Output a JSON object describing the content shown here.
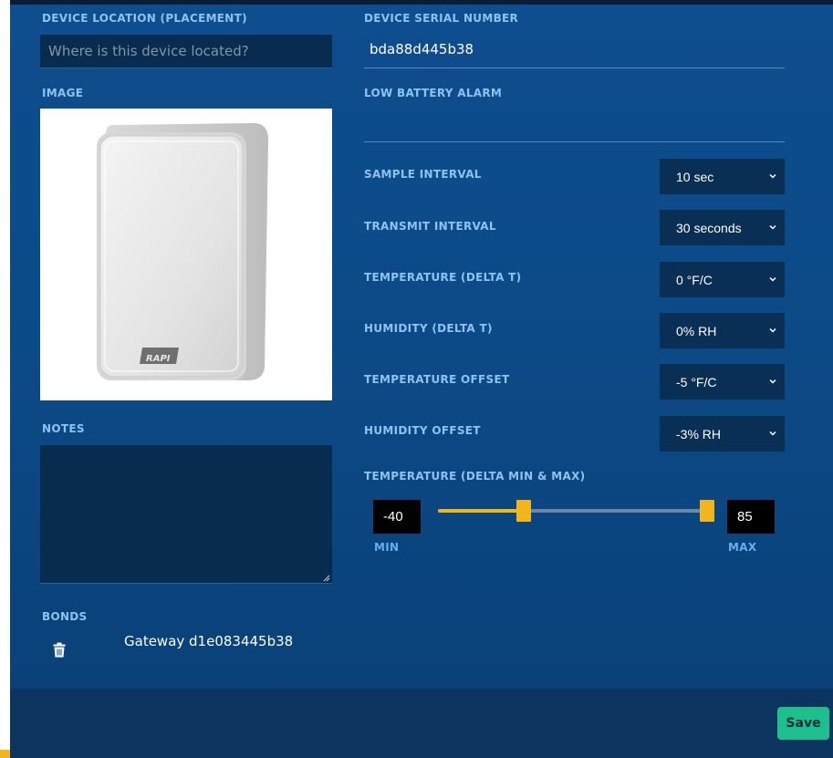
{
  "left": {
    "location_label": "DEVICE LOCATION (PLACEMENT)",
    "location_placeholder": "Where is this device located?",
    "location_value": "",
    "image_label": "IMAGE",
    "image_brand": "RAPI",
    "notes_label": "NOTES",
    "notes_value": "",
    "bonds_label": "BONDS",
    "bonds": [
      {
        "name": "Gateway d1e083445b38"
      }
    ]
  },
  "right": {
    "serial_label": "DEVICE SERIAL NUMBER",
    "serial_value": "bda88d445b38",
    "battery_label": "LOW BATTERY ALARM",
    "battery_value": "",
    "settings": [
      {
        "label": "SAMPLE INTERVAL",
        "value": "10 sec"
      },
      {
        "label": "TRANSMIT INTERVAL",
        "value": "30 seconds"
      },
      {
        "label": "TEMPERATURE (DELTA T)",
        "value": "0 °F/C"
      },
      {
        "label": "HUMIDITY (DELTA T)",
        "value": "0% RH"
      },
      {
        "label": "TEMPERATURE OFFSET",
        "value": "-5 °F/C"
      },
      {
        "label": "HUMIDITY OFFSET",
        "value": "-3% RH"
      }
    ],
    "range": {
      "label": "TEMPERATURE (DELTA MIN & MAX)",
      "min_value": "-40",
      "max_value": "85",
      "min_label": "MIN",
      "max_label": "MAX",
      "low_fraction": 0.32,
      "high_fraction": 1.0
    }
  },
  "footer": {
    "save_label": "Save"
  },
  "colors": {
    "accent": "#f2b51a",
    "save": "#1dbf8f",
    "label": "#8ec3ef",
    "panel": "#0e4d8e"
  },
  "icons": {
    "select_chevron": "chevron-down-icon",
    "bond_delete": "trash-icon",
    "notes_resize": "resize-grip-icon"
  }
}
